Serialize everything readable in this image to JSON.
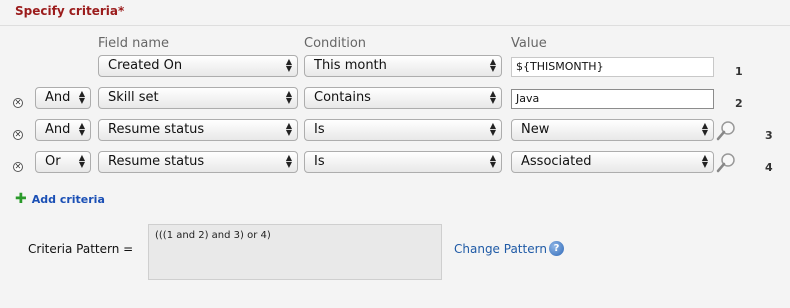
{
  "section": {
    "title": "Specify criteria*"
  },
  "headers": {
    "field": "Field name",
    "condition": "Condition",
    "value": "Value"
  },
  "rows": [
    {
      "number": "1",
      "operator": "",
      "field": "Created On",
      "condition": "This month",
      "value": "${THISMONTH}",
      "value_type": "text"
    },
    {
      "number": "2",
      "operator": "And",
      "field": "Skill set",
      "condition": "Contains",
      "value": "Java",
      "value_type": "text"
    },
    {
      "number": "3",
      "operator": "And",
      "field": "Resume status",
      "condition": "Is",
      "value": "New",
      "value_type": "select"
    },
    {
      "number": "4",
      "operator": "Or",
      "field": "Resume status",
      "condition": "Is",
      "value": "Associated",
      "value_type": "select"
    }
  ],
  "add_criteria": {
    "label": "Add criteria"
  },
  "criteria_pattern": {
    "label": "Criteria Pattern =",
    "value": "(((1 and 2) and 3) or 4)"
  },
  "change_pattern": {
    "label": "Change Pattern"
  },
  "icons": {
    "remove": "remove-circle-icon",
    "lookup": "magnifier-icon",
    "add": "plus-icon",
    "help": "help-icon"
  }
}
